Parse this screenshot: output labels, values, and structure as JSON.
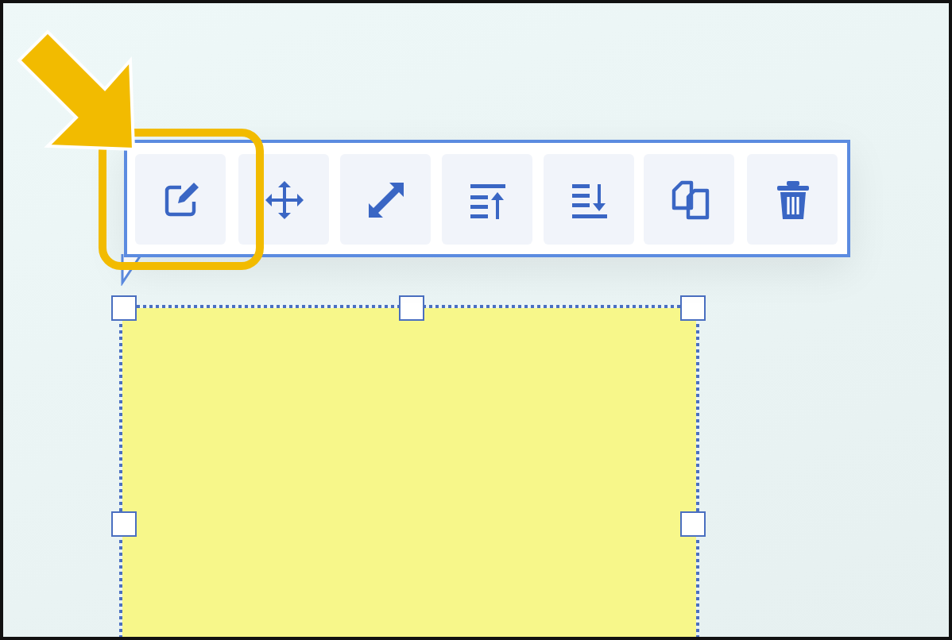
{
  "toolbar": {
    "buttons": [
      {
        "kind": "edit",
        "highlighted": true
      },
      {
        "kind": "move",
        "highlighted": false
      },
      {
        "kind": "resize",
        "highlighted": false
      },
      {
        "kind": "bring-forward",
        "highlighted": false
      },
      {
        "kind": "send-backward",
        "highlighted": false
      },
      {
        "kind": "duplicate",
        "highlighted": false
      },
      {
        "kind": "delete",
        "highlighted": false
      }
    ]
  },
  "shape": {
    "selected": true
  }
}
